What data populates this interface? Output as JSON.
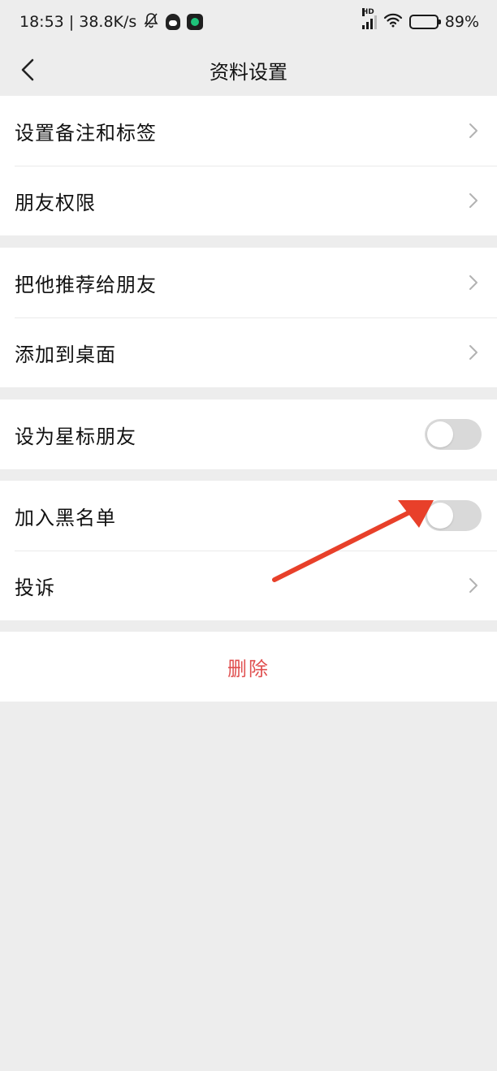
{
  "status_bar": {
    "time_speed": "18:53 | 38.8K/s",
    "hd_label": "HD",
    "battery": "89%"
  },
  "nav": {
    "title": "资料设置"
  },
  "sections": {
    "remark": {
      "label": "设置备注和标签"
    },
    "permissions": {
      "label": "朋友权限"
    },
    "recommend": {
      "label": "把他推荐给朋友"
    },
    "desktop": {
      "label": "添加到桌面"
    },
    "star": {
      "label": "设为星标朋友",
      "on": false
    },
    "blacklist": {
      "label": "加入黑名单",
      "on": false
    },
    "complaint": {
      "label": "投诉"
    }
  },
  "delete": {
    "label": "删除"
  },
  "colors": {
    "delete_text": "#e05050",
    "annotation_arrow": "#e8402a",
    "toggle_off": "#d9d9d9"
  }
}
